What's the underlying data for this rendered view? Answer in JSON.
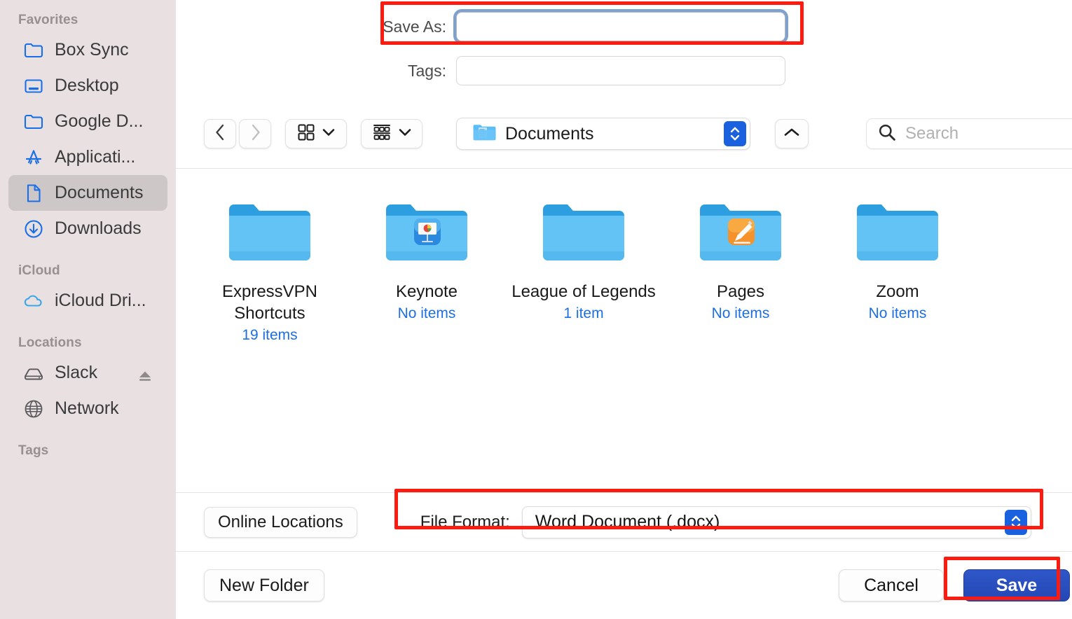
{
  "sidebar": {
    "sections": [
      {
        "header": "Favorites",
        "items": [
          {
            "label": "Box Sync",
            "icon": "folder-icon",
            "selected": false,
            "eject": false
          },
          {
            "label": "Desktop",
            "icon": "desktop-icon",
            "selected": false,
            "eject": false
          },
          {
            "label": "Google D...",
            "icon": "folder-icon",
            "selected": false,
            "eject": false
          },
          {
            "label": "Applicati...",
            "icon": "app-store-icon",
            "selected": false,
            "eject": false
          },
          {
            "label": "Documents",
            "icon": "document-icon",
            "selected": true,
            "eject": false
          },
          {
            "label": "Downloads",
            "icon": "download-icon",
            "selected": false,
            "eject": false
          }
        ]
      },
      {
        "header": "iCloud",
        "items": [
          {
            "label": "iCloud Dri...",
            "icon": "cloud-icon",
            "selected": false,
            "eject": false
          }
        ]
      },
      {
        "header": "Locations",
        "items": [
          {
            "label": "Slack",
            "icon": "disk-icon",
            "selected": false,
            "eject": true
          },
          {
            "label": "Network",
            "icon": "network-icon",
            "selected": false,
            "eject": false
          }
        ]
      },
      {
        "header": "Tags",
        "items": []
      }
    ]
  },
  "fields": {
    "save_as_label": "Save As:",
    "save_as_value": "",
    "save_as_placeholder": "",
    "tags_label": "Tags:",
    "tags_value": "",
    "tags_placeholder": ""
  },
  "toolbar": {
    "back_icon": "chevron-left-icon",
    "forward_icon": "chevron-right-icon",
    "view_icon": "icon-view-icon",
    "group_icon": "group-by-icon",
    "path_label": "Documents",
    "path_icon": "documents-folder-icon",
    "up_icon": "chevron-up-icon",
    "search_icon": "search-icon",
    "search_placeholder": "Search",
    "search_value": ""
  },
  "files": [
    {
      "name": "ExpressVPN Shortcuts",
      "meta": "19 items",
      "badge": "none"
    },
    {
      "name": "Keynote",
      "meta": "No items",
      "badge": "keynote"
    },
    {
      "name": "League of Legends",
      "meta": "1 item",
      "badge": "none"
    },
    {
      "name": "Pages",
      "meta": "No items",
      "badge": "pages"
    },
    {
      "name": "Zoom",
      "meta": "No items",
      "badge": "none"
    }
  ],
  "format_bar": {
    "online_locations_label": "Online Locations",
    "file_format_label": "File Format:",
    "file_format_value": "Word Document (.docx)"
  },
  "actions": {
    "new_folder_label": "New Folder",
    "cancel_label": "Cancel",
    "save_label": "Save"
  },
  "colors": {
    "sidebar_bg": "#e9e0e2",
    "selected_row": "#cdc7c8",
    "accent_blue": "#1a61e0",
    "save_blue": "#2a50c0",
    "meta_blue": "#1d6fe0",
    "annotation_red": "#fb1b10",
    "focus_ring": "#7ea2cf",
    "folder_blue": "#4db5f0"
  }
}
